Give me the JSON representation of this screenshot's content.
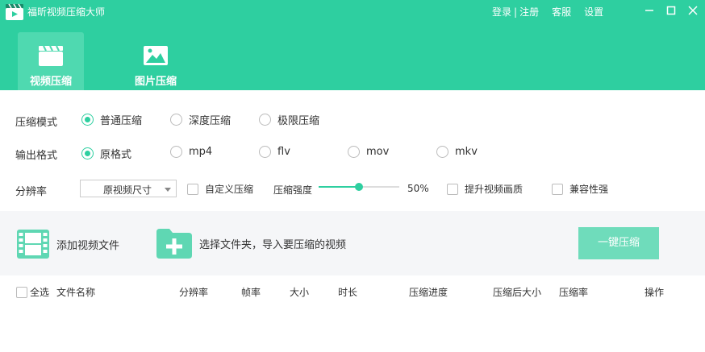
{
  "app": {
    "title": "福昕视频压缩大师"
  },
  "top_links": {
    "login": "登录",
    "separator": "|",
    "register": "注册",
    "service": "客服",
    "settings": "设置"
  },
  "tabs": [
    {
      "label": "视频压缩",
      "icon": "clapperboard-icon",
      "active": true
    },
    {
      "label": "图片压缩",
      "icon": "image-icon",
      "active": false
    }
  ],
  "options": {
    "mode": {
      "label": "压缩模式",
      "choices": [
        "普通压缩",
        "深度压缩",
        "极限压缩"
      ],
      "selected": "普通压缩"
    },
    "format": {
      "label": "输出格式",
      "choices": [
        "原格式",
        "mp4",
        "flv",
        "mov",
        "mkv"
      ],
      "selected": "原格式"
    },
    "resolution": {
      "label": "分辨率",
      "value": "原视频尺寸",
      "custom_label": "自定义压缩",
      "strength_label": "压缩强度",
      "strength_value": "50%",
      "strength_fraction": 0.5,
      "enhance_label": "提升视频画质",
      "compat_label": "兼容性强"
    }
  },
  "actions": {
    "add_file": "添加视频文件",
    "add_folder": "选择文件夹，导入要压缩的视频",
    "compress": "一键压缩"
  },
  "table": {
    "select_all": "全选",
    "columns": [
      "文件名称",
      "分辨率",
      "帧率",
      "大小",
      "时长",
      "压缩进度",
      "压缩后大小",
      "压缩率",
      "操作"
    ]
  },
  "colors": {
    "accent": "#2ecfa0",
    "accent_light": "#4fd9b0",
    "button": "#6fdcbb"
  }
}
